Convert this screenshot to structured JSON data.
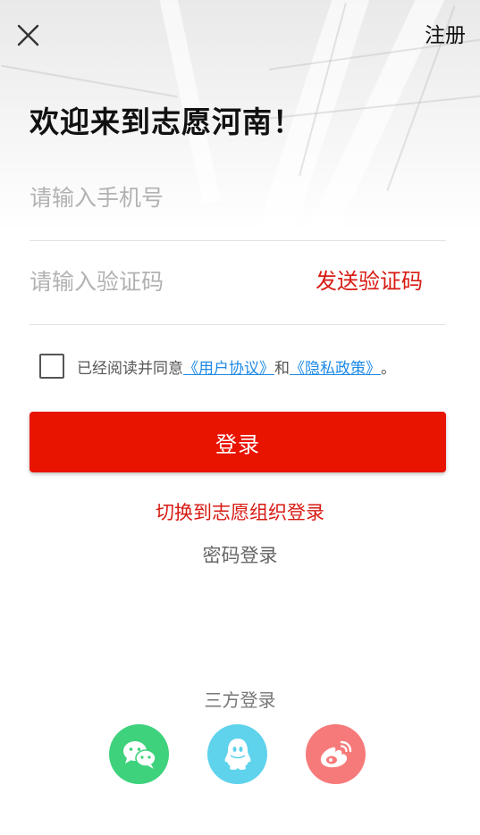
{
  "header": {
    "register_label": "注册"
  },
  "title": "欢迎来到志愿河南！",
  "phone": {
    "placeholder": "请输入手机号",
    "value": ""
  },
  "code": {
    "placeholder": "请输入验证码",
    "value": "",
    "send_label": "发送验证码"
  },
  "agreement": {
    "prefix": "已经阅读并同意",
    "user_agreement": "《用户协议》",
    "and": "和",
    "privacy_policy": "《隐私政策》",
    "suffix": "。"
  },
  "login_label": "登录",
  "switch_org_label": "切换到志愿组织登录",
  "password_login_label": "密码登录",
  "third_party": {
    "title": "三方登录",
    "providers": [
      {
        "icon": "wechat-icon",
        "color": "#3ed27c"
      },
      {
        "icon": "qq-icon",
        "color": "#5fd2ec"
      },
      {
        "icon": "weibo-icon",
        "color": "#f77a7a"
      }
    ]
  },
  "colors": {
    "primary_red": "#e81400",
    "link_blue": "#1e8ae6"
  }
}
